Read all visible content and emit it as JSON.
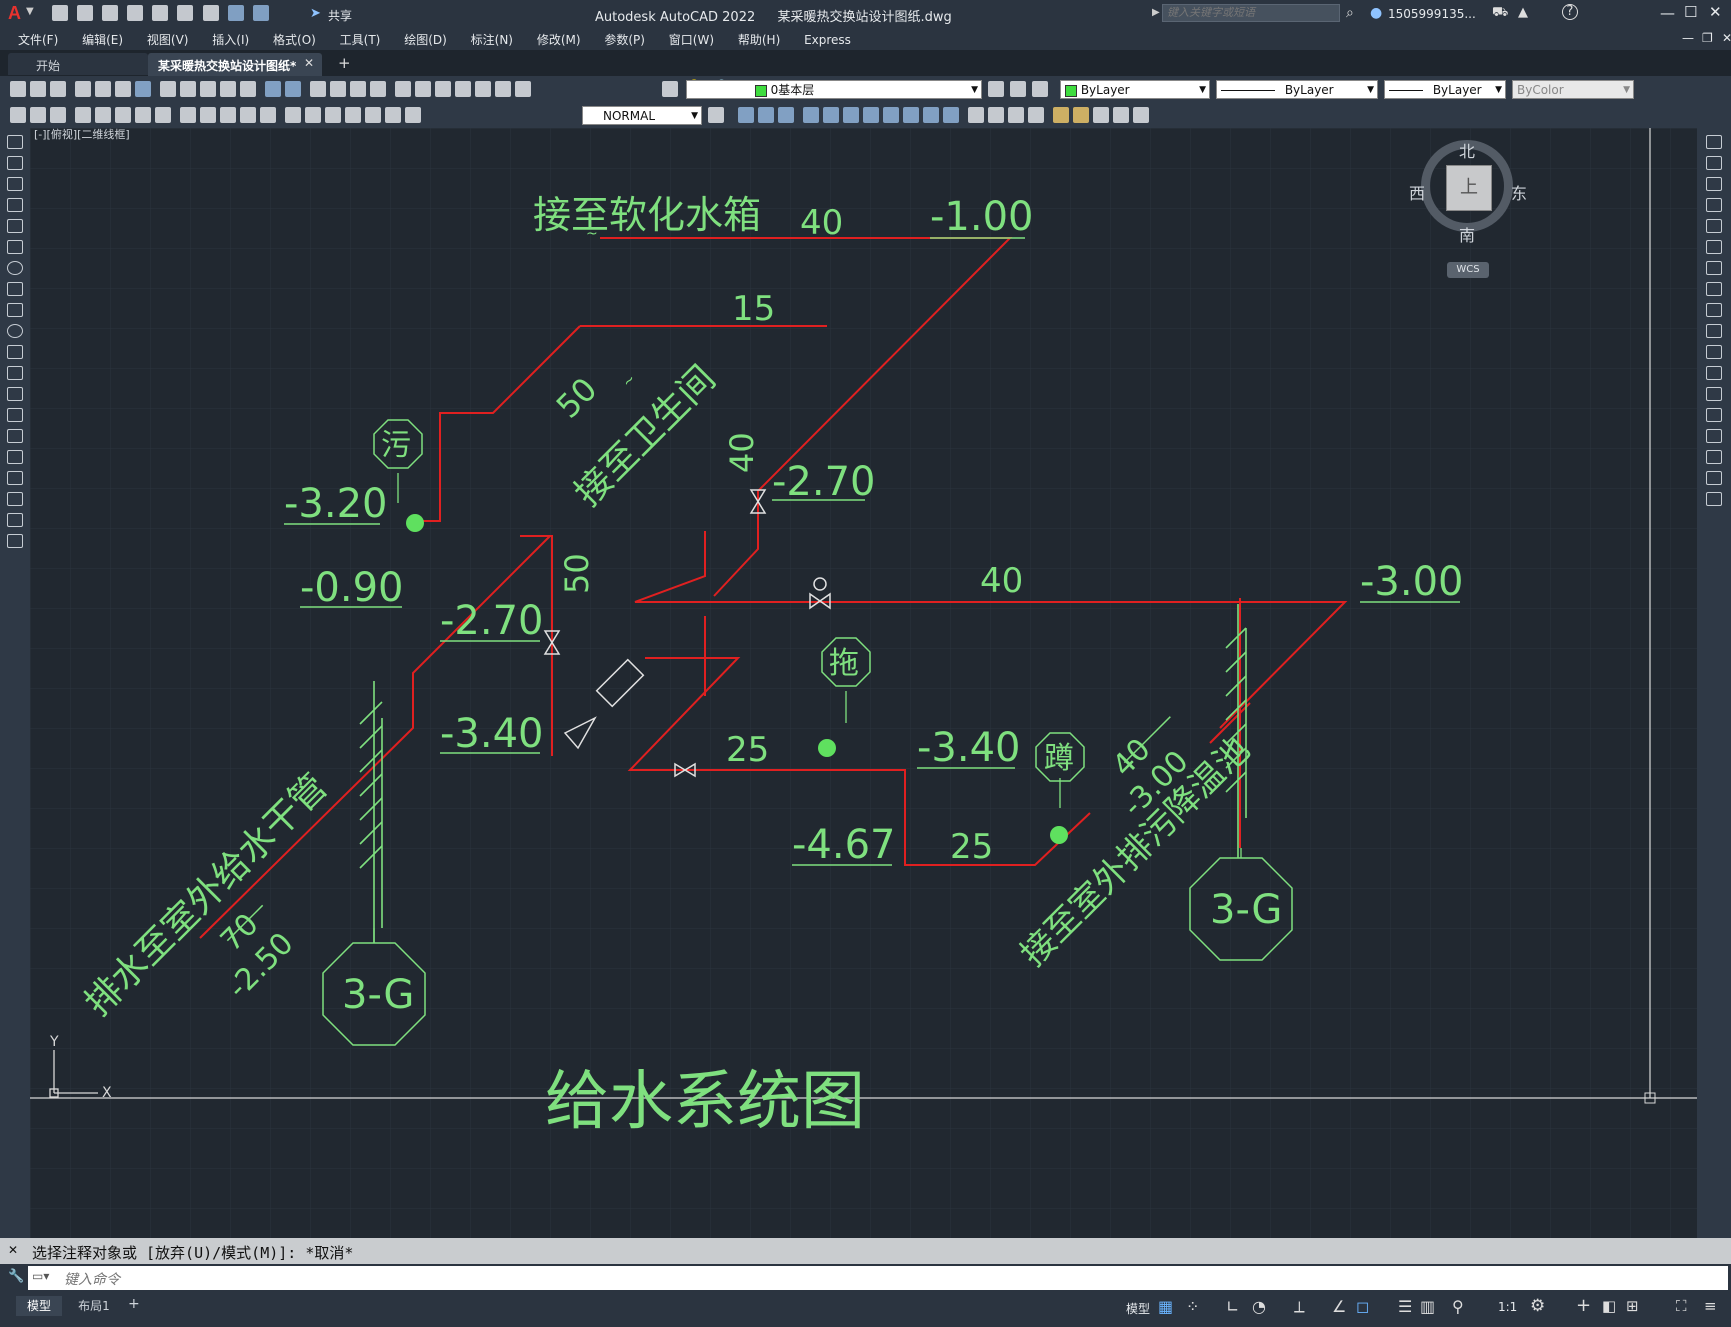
{
  "app": {
    "title": "Autodesk AutoCAD 2022",
    "document": "某采暖热交换站设计图纸.dwg",
    "share_label": "共享",
    "search_placeholder": "键入关键字或短语",
    "user": "1505999135...",
    "logo": "A"
  },
  "menu": [
    "文件(F)",
    "编辑(E)",
    "视图(V)",
    "插入(I)",
    "格式(O)",
    "工具(T)",
    "绘图(D)",
    "标注(N)",
    "修改(M)",
    "参数(P)",
    "窗口(W)",
    "帮助(H)",
    "Express"
  ],
  "tabs": [
    {
      "label": "开始",
      "active": false
    },
    {
      "label": "某采暖热交换站设计图纸*",
      "active": true
    }
  ],
  "toolbar": {
    "layer": "0基本层",
    "color": "ByLayer",
    "linetype": "ByLayer",
    "lineweight": "ByLayer",
    "plotstyle": "ByColor",
    "textstyle": "NORMAL"
  },
  "viewport": {
    "label": "[-][俯视][二维线框]",
    "viewcube": {
      "north": "北",
      "south": "南",
      "east": "东",
      "west": "西",
      "top": "上",
      "wcs": "WCS"
    },
    "ucs": {
      "x": "X",
      "y": "Y"
    }
  },
  "drawing": {
    "title": "给水系统图",
    "labels": {
      "to_softener": "接至软化水箱",
      "to_restroom": "接至卫生间",
      "to_outdoor_main": "排水至室外给水干管",
      "to_outdoor_pool": "接至室外排污降温池"
    },
    "elevations": [
      "-1.00",
      "-2.70",
      "-3.20",
      "-0.90",
      "-2.70",
      "-3.40",
      "-3.40",
      "-4.67",
      "-3.00"
    ],
    "sizes": [
      "40",
      "15",
      "50",
      "40",
      "50",
      "40",
      "25",
      "25"
    ],
    "fractions": [
      {
        "num": "70",
        "den": "-2.50"
      },
      {
        "num": "40",
        "den": "-3.00"
      }
    ],
    "fixtures": {
      "sewage": "污",
      "mop": "拖",
      "squat": "蹲"
    },
    "riser_tag": "3-G",
    "wave_mark": "~"
  },
  "command": {
    "history": "选择注释对象或 [放弃(U)/模式(M)]: *取消*",
    "placeholder": "键入命令"
  },
  "status": {
    "layout_tabs": [
      "模型",
      "布局1"
    ],
    "mode_label": "模型",
    "scale": "1:1"
  },
  "colors": {
    "pipe": "#e02020",
    "annotation": "#7fe07f",
    "canvas": "#212830",
    "grid": "#2d3540"
  }
}
